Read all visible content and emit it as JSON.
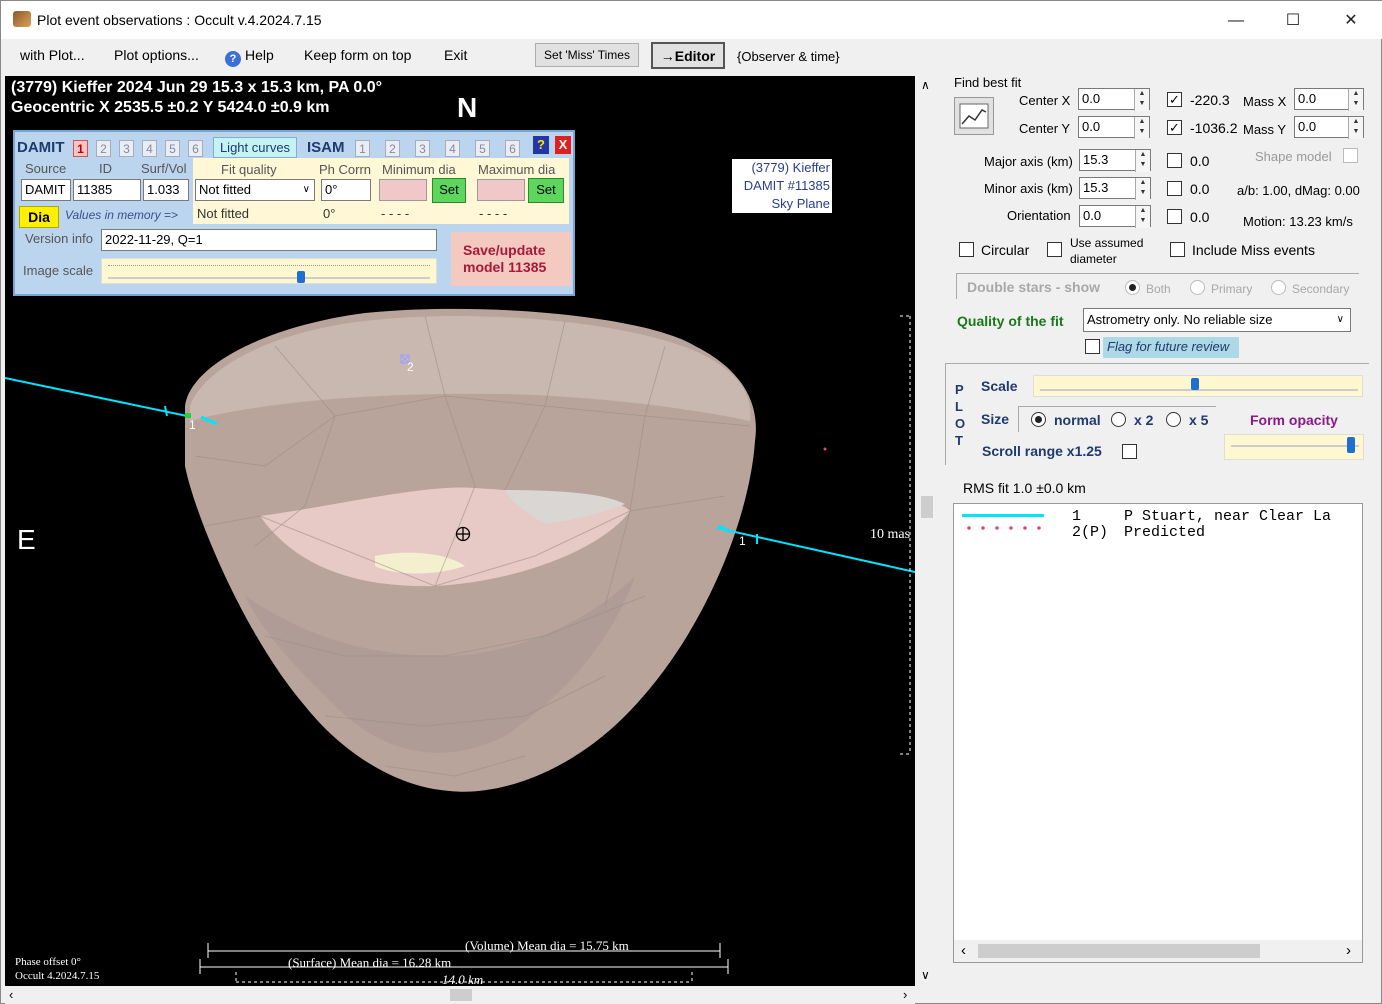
{
  "window": {
    "title": "Plot event observations : Occult v.4.2024.7.15"
  },
  "menu": {
    "with_plot": "with Plot...",
    "plot_options": "Plot options...",
    "help": "Help",
    "keep_on_top": "Keep form on top",
    "exit": "Exit",
    "set_miss_times": "Set 'Miss' Times",
    "editor": "→Editor",
    "observer_time": "{Observer & time}"
  },
  "plot": {
    "header_line1": "(3779) Kieffer  2024 Jun 29   15.3 x 15.3 km, PA 0.0°",
    "header_line2": "Geocentric  X  2535.5 ±0.2  Y 5424.0 ±0.9 km",
    "north": "N",
    "east": "E",
    "scale_label": "10 mas",
    "chord1_label": "1",
    "chord2_label": "2",
    "chord1_end_label": "1",
    "volume_mean": "(Volume) Mean dia = 15.75 km",
    "surface_mean": "(Surface) Mean dia = 16.28 km",
    "km_scale": "14.0 km",
    "phase_offset": "Phase offset 0°",
    "occult_version": "Occult 4.2024.7.15",
    "sky_plane": [
      "(3779) Kieffer",
      "DAMIT #11385",
      "Sky Plane"
    ]
  },
  "damit": {
    "title": "DAMIT",
    "tabs": [
      "1",
      "2",
      "3",
      "4",
      "5",
      "6"
    ],
    "light_curves": "Light curves",
    "isam": "ISAM",
    "isam_tabs": [
      "1",
      "2",
      "3",
      "4",
      "5",
      "6"
    ],
    "help_btn": "?",
    "close_btn": "X",
    "source_label": "Source",
    "id_label": "ID",
    "surfvol_label": "Surf/Vol",
    "source_value": "DAMIT",
    "id_value": "11385",
    "surfvol_value": "1.033",
    "fit_quality_label": "Fit quality",
    "fit_quality_value": "Not fitted",
    "fit_quality_memory": "Not fitted",
    "ph_corrn_label": "Ph Corrn",
    "ph_corrn_value": "0°",
    "ph_corrn_memory": "0°",
    "min_dia_label": "Minimum dia",
    "max_dia_label": "Maximum dia",
    "min_dia_memory": "- - - -",
    "max_dia_memory": "- - - -",
    "set": "Set",
    "dia_btn": "Dia",
    "values_in_memory": "Values in memory =>",
    "version_label": "Version info",
    "version_value": "2022-11-29, Q=1",
    "image_scale_label": "Image scale",
    "image_scale_fraction": 0.6,
    "save_update": [
      "Save/update",
      "model  11385"
    ]
  },
  "fit": {
    "find_best_fit": "Find best fit",
    "center_x_label": "Center X",
    "center_y_label": "Center Y",
    "center_x": "0.0",
    "center_y": "0.0",
    "fit_x_value": "-220.3",
    "fit_y_value": "-1036.2",
    "mass_x_label": "Mass X",
    "mass_y_label": "Mass Y",
    "mass_x": "0.0",
    "mass_y": "0.0",
    "major_label": "Major axis (km)",
    "minor_label": "Minor axis (km)",
    "orient_label": "Orientation",
    "major": "15.3",
    "minor": "15.3",
    "orientation": "0.0",
    "major_chk_value": "0.0",
    "minor_chk_value": "0.0",
    "orient_chk_value": "0.0",
    "shape_model": "Shape model",
    "ab_dmag": "a/b: 1.00, dMag: 0.00",
    "motion": "Motion: 13.23 km/s",
    "circular": "Circular",
    "use_assumed": [
      "Use assumed",
      "diameter"
    ],
    "include_miss": "Include Miss events",
    "double_stars": "Double stars - show",
    "both": "Both",
    "primary": "Primary",
    "secondary": "Secondary",
    "quality_label": "Quality of the fit",
    "quality_value": "Astrometry only. No reliable size",
    "flag_review": "Flag for future review"
  },
  "plot_ctrl": {
    "plot_letters": [
      "P",
      "L",
      "O",
      "T"
    ],
    "scale": "Scale",
    "scale_fraction": 0.49,
    "size": "Size",
    "normal": "normal",
    "x2": "x 2",
    "x5": "x 5",
    "form_opacity": "Form opacity",
    "opacity_fraction": 0.95,
    "scroll_range": "Scroll range x1.25",
    "rms": "RMS fit  1.0 ±0.0 km"
  },
  "legend": [
    {
      "num": "1",
      "text": "P Stuart, near Clear La",
      "color": "#00e5ff",
      "style": "solid"
    },
    {
      "num": "2(P)",
      "text": "Predicted",
      "color": "#e0457a",
      "style": "dotted"
    }
  ],
  "colors": {
    "chord": "#00e5ff",
    "damit_panel": "#bcd5ee",
    "asteroid": "#b8a49b"
  }
}
